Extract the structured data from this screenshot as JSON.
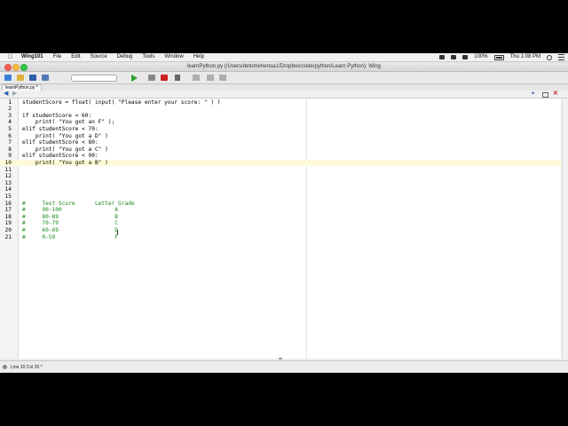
{
  "menubar": {
    "app_name": "Wing101",
    "items": [
      "File",
      "Edit",
      "Source",
      "Debug",
      "Tools",
      "Window",
      "Help"
    ],
    "battery": "100%",
    "clock": "Thu 1:08 PM"
  },
  "window": {
    "title": "learnPython.py (/Users/detomehenoa1/Dropbox/code/python/Learn Python): Wing"
  },
  "editor": {
    "tab_label": "learnPython.py *",
    "lines": [
      {
        "n": "1",
        "text": "studentScore = float( input( \"Please enter your score: \" ) )"
      },
      {
        "n": "2",
        "text": ""
      },
      {
        "n": "3",
        "text": "if studentScore < 60:"
      },
      {
        "n": "4",
        "text": "    print( \"You got an F\" );"
      },
      {
        "n": "5",
        "text": "elif studentScore < 70:"
      },
      {
        "n": "6",
        "text": "    print( \"You got a D\" )"
      },
      {
        "n": "7",
        "text": "elif studentScore < 80:"
      },
      {
        "n": "8",
        "text": "    print( \"You got a C\" )"
      },
      {
        "n": "9",
        "text": "elif studentScore < 90:"
      },
      {
        "n": "10",
        "text": "    print( \"You got a B\" )"
      },
      {
        "n": "11",
        "text": ""
      },
      {
        "n": "12",
        "text": ""
      },
      {
        "n": "13",
        "text": ""
      },
      {
        "n": "14",
        "text": ""
      },
      {
        "n": "15",
        "text": ""
      },
      {
        "n": "16",
        "text": "#     Test Score      Letter Grade"
      },
      {
        "n": "17",
        "text": "#     90-100                A"
      },
      {
        "n": "18",
        "text": "#     80-89                 B"
      },
      {
        "n": "19",
        "text": "#     70-79                 C"
      },
      {
        "n": "20",
        "text": "#     60-69                 D"
      },
      {
        "n": "21",
        "text": "#     0-59                  F"
      }
    ]
  },
  "status": {
    "text": "Line 10 Col 26 *"
  }
}
